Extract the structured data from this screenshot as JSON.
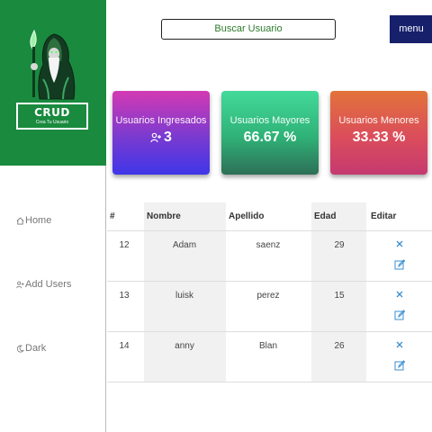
{
  "brand": {
    "title": "CRUD",
    "subtitle": "Crea Tu Usuario"
  },
  "nav": [
    {
      "label": "Home",
      "icon": "home-icon"
    },
    {
      "label": "Add Users",
      "icon": "add-user-icon"
    },
    {
      "label": "Dark",
      "icon": "moon-icon"
    }
  ],
  "search": {
    "label": "Buscar Usuario"
  },
  "menu": {
    "label": "menu"
  },
  "cards": [
    {
      "title": "Usuarios Ingresados",
      "value": "3",
      "icon": "add-user-icon"
    },
    {
      "title": "Usuarios Mayores",
      "value": "66.67 %"
    },
    {
      "title": "Usuarios Menores",
      "value": "33.33 %"
    }
  ],
  "table": {
    "headers": [
      "#",
      "Nombre",
      "Apellido",
      "Edad",
      "Editar"
    ],
    "rows": [
      {
        "id": "12",
        "nombre": "Adam",
        "apellido": "saenz",
        "edad": "29"
      },
      {
        "id": "13",
        "nombre": "luisk",
        "apellido": "perez",
        "edad": "15"
      },
      {
        "id": "14",
        "nombre": "anny",
        "apellido": "Blan",
        "edad": "26"
      }
    ]
  },
  "colors": {
    "sidebar_brand": "#1a8a3e",
    "menu_button": "#17206b",
    "action_icons": "#3a8fd0"
  }
}
